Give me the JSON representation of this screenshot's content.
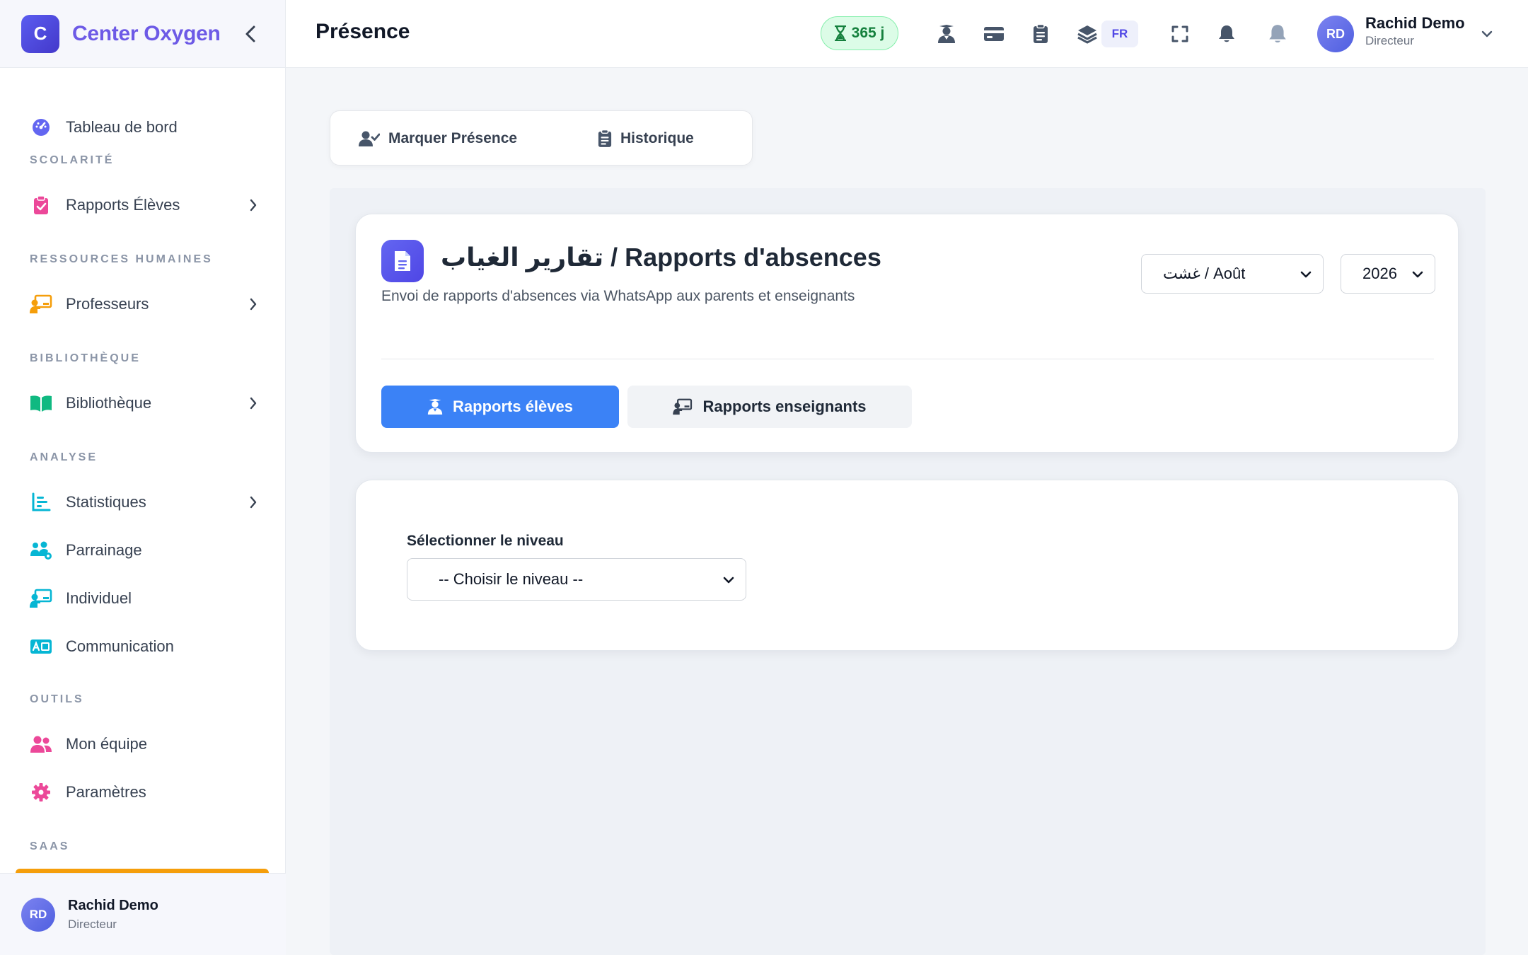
{
  "brand": {
    "logo_letter": "C",
    "name": "Center Oxygen"
  },
  "sidebar": {
    "dashboard": "Tableau de bord",
    "sections": {
      "scolarite": "SCOLARITÉ",
      "rh": "RESSOURCES HUMAINES",
      "bibliotheque": "BIBLIOTHÈQUE",
      "analyse": "ANALYSE",
      "outils": "OUTILS",
      "saas": "SAAS"
    },
    "items": {
      "rapports_eleves": "Rapports Élèves",
      "professeurs": "Professeurs",
      "bibliotheque": "Bibliothèque",
      "statistiques": "Statistiques",
      "parrainage": "Parrainage",
      "individuel": "Individuel",
      "communication": "Communication",
      "mon_equipe": "Mon équipe",
      "parametres": "Paramètres"
    },
    "user": {
      "initials": "RD",
      "name": "Rachid Demo",
      "role": "Directeur"
    }
  },
  "topbar": {
    "title": "Présence",
    "trial_days": "365 j",
    "lang": "FR",
    "user": {
      "initials": "RD",
      "name": "Rachid Demo",
      "role": "Directeur"
    },
    "icons": [
      "graduate-icon",
      "card-icon",
      "clipboard-icon",
      "layers-icon",
      "fullscreen-icon",
      "bell-icon",
      "bell-icon"
    ]
  },
  "tabs": {
    "mark": "Marquer Présence",
    "history": "Historique"
  },
  "report": {
    "title": "تقارير الغياب / Rapports d'absences",
    "subtitle": "Envoi de rapports d'absences via WhatsApp aux parents et enseignants",
    "month": "غشت / Août",
    "year": "2026",
    "btn_students": "Rapports élèves",
    "btn_teachers": "Rapports enseignants"
  },
  "level": {
    "label": "Sélectionner le niveau",
    "placeholder": "-- Choisir le niveau --"
  },
  "colors": {
    "accent": "#6d5ae6",
    "primary_button": "#3b82f6",
    "trial_badge": "#15803d",
    "orange_strip": "#f59e0b"
  }
}
